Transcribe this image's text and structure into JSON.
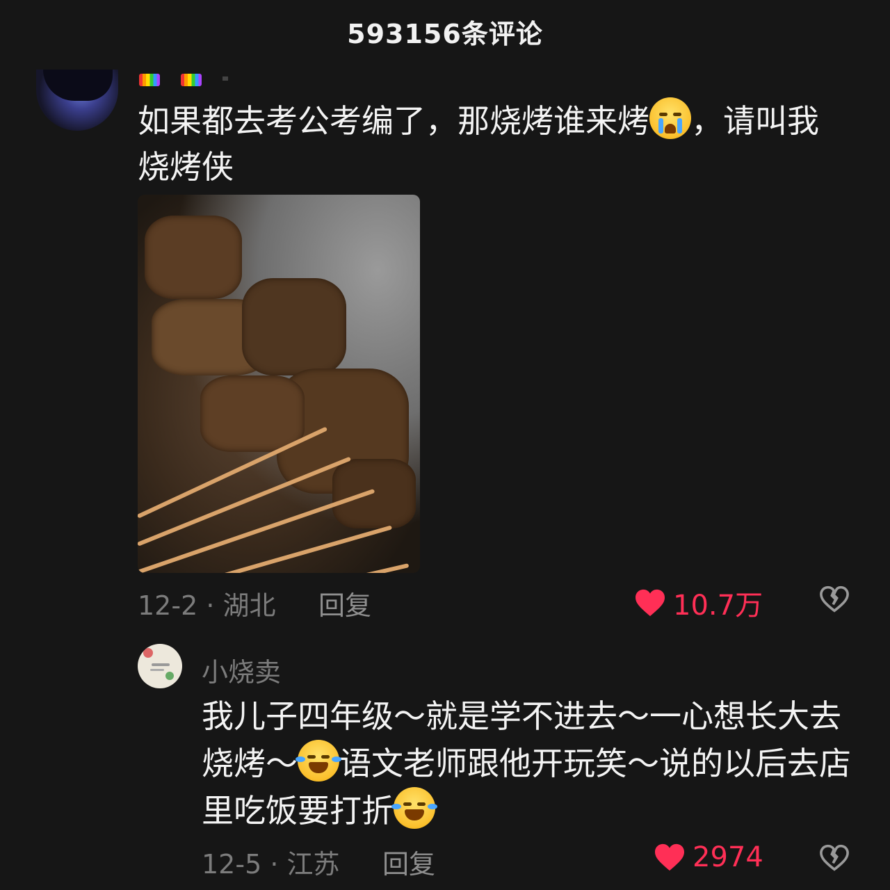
{
  "header": {
    "title": "593156条评论"
  },
  "comment1": {
    "text_part1": "如果都去考公考编了，那烧烤谁来烤",
    "emoji1": "loudly-crying-face-emoji",
    "text_part2": "，请叫我烧烤侠",
    "date_location": "12-2 · 湖北",
    "reply_label": "回复",
    "like_count": "10.7万",
    "liked": true
  },
  "comment2": {
    "username": "小烧卖",
    "text_part1": "我儿子四年级～就是学不进去～一心想长大去烧烤～",
    "emoji1": "rolling-on-floor-laughing-emoji",
    "text_part2": "语文老师跟他开玩笑～说的以后去店里吃饭要打折",
    "emoji2": "rolling-on-floor-laughing-emoji",
    "date_location": "12-5 · 江苏",
    "reply_label": "回复",
    "like_count": "2974",
    "liked": true
  },
  "colors": {
    "like": "#ff2f56",
    "background": "#161616",
    "muted": "#7c7c7c"
  }
}
